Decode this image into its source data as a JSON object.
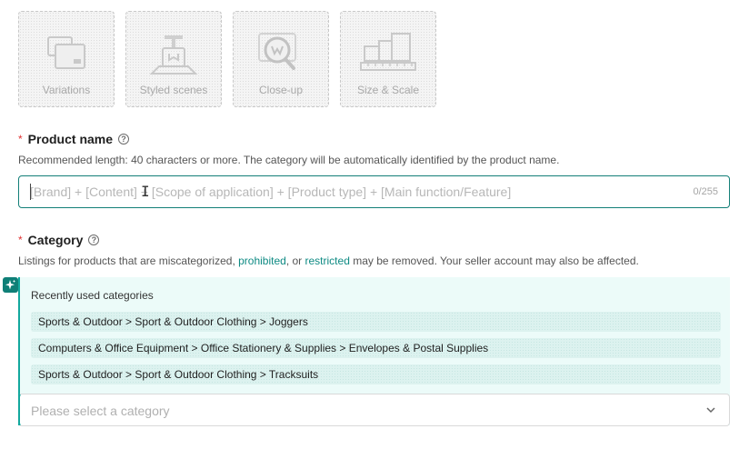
{
  "image_slots": [
    {
      "label": "Variations",
      "icon": "variations-icon"
    },
    {
      "label": "Styled scenes",
      "icon": "styled-scenes-icon"
    },
    {
      "label": "Close-up",
      "icon": "close-up-icon"
    },
    {
      "label": "Size & Scale",
      "icon": "size-scale-icon"
    }
  ],
  "product_name": {
    "required_mark": "*",
    "label": "Product name",
    "hint": "Recommended length: 40 characters or more. The category will be automatically identified by the product name.",
    "placeholder": "[Brand] + [Content] + [Scope of application] + [Product type] + [Main function/Feature]",
    "counter": "0/255"
  },
  "category": {
    "required_mark": "*",
    "label": "Category",
    "hint_before": "Listings for products that are miscategorized, ",
    "hint_link1": "prohibited",
    "hint_middle": ", or ",
    "hint_link2": "restricted",
    "hint_after": " may be removed. Your seller account may also be affected.",
    "recent_title": "Recently used categories",
    "recent_items": [
      "Sports & Outdoor > Sport & Outdoor Clothing > Joggers",
      "Computers & Office Equipment > Office Stationery & Supplies > Envelopes & Postal Supplies",
      "Sports & Outdoor > Sport & Outdoor Clothing > Tracksuits"
    ],
    "select_placeholder": "Please select a category"
  },
  "colors": {
    "accent": "#137f78",
    "link": "#0e8a83",
    "required": "#e03131",
    "recent_bg": "#ecfbf9"
  }
}
